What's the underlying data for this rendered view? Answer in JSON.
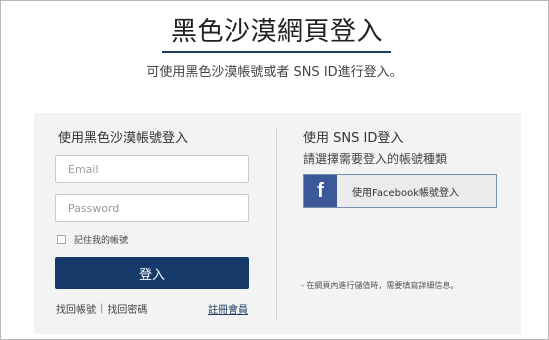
{
  "header": {
    "title": "黑色沙漠網頁登入",
    "subtitle": "可使用黑色沙漠帳號或者 SNS ID進行登入。"
  },
  "account_login": {
    "heading": "使用黑色沙漠帳號登入",
    "email_placeholder": "Email",
    "password_placeholder": "Password",
    "remember_label": "記住我的帳號",
    "login_button": "登入",
    "find_account": "找回帳號",
    "separator": "|",
    "find_password": "找回密碼",
    "register": "註冊會員"
  },
  "sns_login": {
    "heading": "使用 SNS ID登入",
    "subheading": "請選擇需要登入的帳號種類",
    "facebook_icon_letter": "f",
    "facebook_button": "使用Facebook帳號登入",
    "note": "- 在網頁內進行儲值時，需要填寫詳細信息。"
  },
  "colors": {
    "brand_navy": "#153a69",
    "facebook_blue": "#3b5998",
    "panel_bg": "#f3f3f3"
  },
  "icons": {
    "facebook": "facebook-icon"
  }
}
